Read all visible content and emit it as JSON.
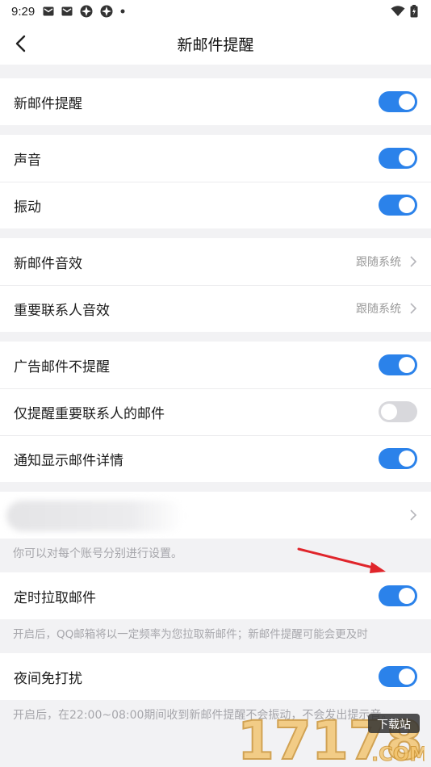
{
  "status_bar": {
    "time": "9:29"
  },
  "header": {
    "title": "新邮件提醒"
  },
  "groups": [
    {
      "rows": [
        {
          "label": "新邮件提醒",
          "toggle": true
        }
      ]
    },
    {
      "rows": [
        {
          "label": "声音",
          "toggle": true
        },
        {
          "label": "振动",
          "toggle": true
        }
      ]
    },
    {
      "rows": [
        {
          "label": "新邮件音效",
          "value": "跟随系统"
        },
        {
          "label": "重要联系人音效",
          "value": "跟随系统"
        }
      ]
    },
    {
      "rows": [
        {
          "label": "广告邮件不提醒",
          "toggle": true
        },
        {
          "label": "仅提醒重要联系人的邮件",
          "toggle": false
        },
        {
          "label": "通知显示邮件详情",
          "toggle": true
        }
      ]
    }
  ],
  "account_note": "你可以对每个账号分别进行设置。",
  "scheduled_fetch": {
    "label": "定时拉取邮件",
    "toggle": true,
    "note": "开启后，QQ邮箱将以一定频率为您拉取新邮件；新邮件提醒可能会更及时"
  },
  "dnd": {
    "label": "夜间免打扰",
    "toggle": true,
    "note": "开启后，在22:00~08:00期间收到新邮件提醒不会振动，不会发出提示音。"
  },
  "watermark": {
    "text": "17178",
    "badge": "下载站",
    "domain": ".COM"
  },
  "colors": {
    "accent": "#2b82ea",
    "toggle_off": "#d8d8dc",
    "arrow": "#e0252b"
  }
}
